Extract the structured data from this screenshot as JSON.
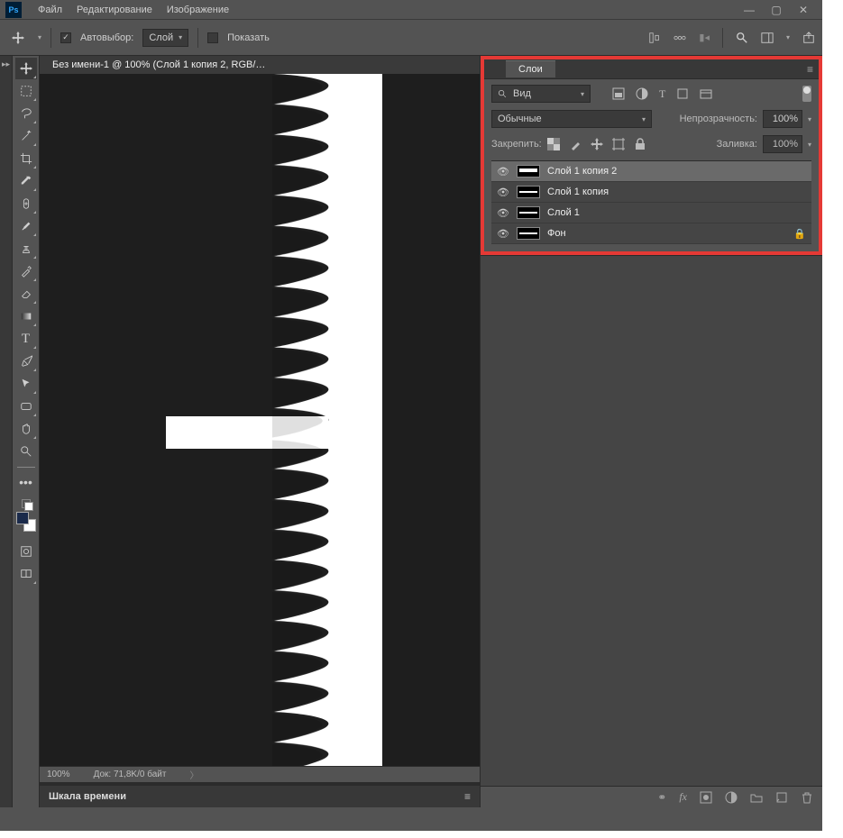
{
  "menubar": {
    "logo": "Ps",
    "items": [
      "Файл",
      "Редактирование",
      "Изображение"
    ]
  },
  "optionsbar": {
    "auto_select_label": "Автовыбор:",
    "layer_select": "Слой",
    "show_label": "Показать"
  },
  "document": {
    "tab_title": "Без имени-1 @ 100% (Слой 1 копия 2, RGB/…",
    "zoom": "100%",
    "doc_size": "Док: 71,8K/0 байт",
    "timeline_label": "Шкала времени"
  },
  "layers_panel": {
    "tab": "Слои",
    "search_kind": "Вид",
    "blend_mode": "Обычные",
    "opacity_label": "Непрозрачность:",
    "opacity_value": "100%",
    "lock_label": "Закрепить:",
    "fill_label": "Заливка:",
    "fill_value": "100%",
    "layers": [
      {
        "name": "Слой 1 копия 2",
        "selected": true,
        "locked": false
      },
      {
        "name": "Слой 1 копия",
        "selected": false,
        "locked": false
      },
      {
        "name": "Слой 1",
        "selected": false,
        "locked": false
      },
      {
        "name": "Фон",
        "selected": false,
        "locked": true
      }
    ]
  }
}
